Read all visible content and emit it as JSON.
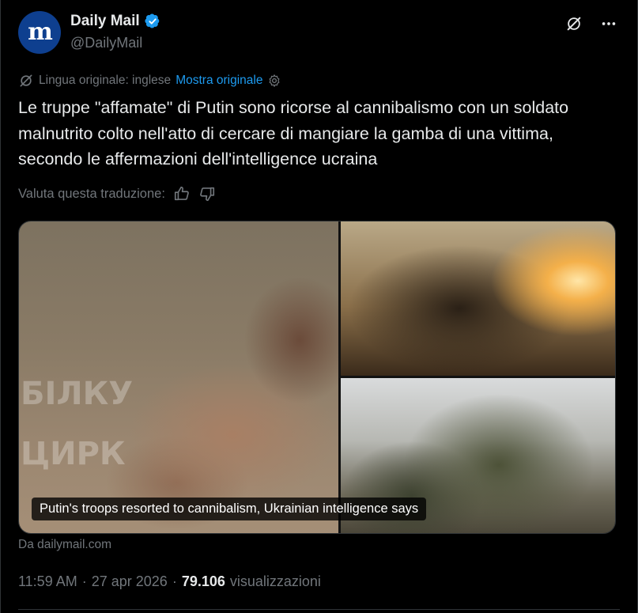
{
  "author": {
    "display_name": "Daily Mail",
    "handle": "@DailyMail",
    "avatar_glyph": "m",
    "verified": true,
    "verified_color": "#1d9bf0",
    "avatar_color": "#0e3f8f"
  },
  "top_actions": {
    "grok_icon": "grok-slash-icon",
    "more_icon": "more-dots-icon"
  },
  "translation": {
    "original_language_label": "Lingua originale: inglese",
    "show_original_link": "Mostra originale",
    "rate_label": "Valuta questa traduzione:"
  },
  "tweet": {
    "text": "Le truppe \"affamate\" di Putin sono ricorse al cannibalismo con un soldato malnutrito colto nell'atto di cercare di mangiare la gamba di una vittima, secondo le affermazioni dell'intelligence ucraina"
  },
  "media": {
    "caption": "Putin's troops resorted to cannibalism, Ukrainian intelligence says",
    "watermark_line1": "БІЛКУ",
    "watermark_line2": "ЦИРК",
    "source": "Da dailymail.com"
  },
  "meta": {
    "time": "11:59 AM",
    "separator1": "·",
    "date": "27 apr 2026",
    "separator2": "·",
    "views_count": "79.106",
    "views_label": "visualizzazioni"
  },
  "colors": {
    "background": "#000000",
    "text_primary": "#e7e9ea",
    "text_secondary": "#71767b",
    "link": "#1d9bf0"
  }
}
